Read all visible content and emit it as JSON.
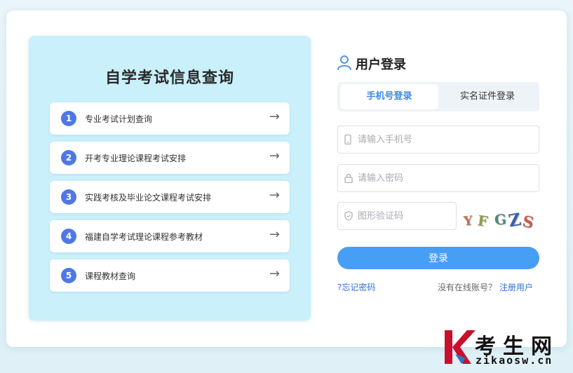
{
  "left_panel": {
    "title": "自学考试信息查询",
    "items": [
      {
        "num": "1",
        "label": "专业考试计划查询"
      },
      {
        "num": "2",
        "label": "开考专业理论课程考试安排"
      },
      {
        "num": "3",
        "label": "实践考核及毕业论文课程考试安排"
      },
      {
        "num": "4",
        "label": "福建自学考试理论课程参考教材"
      },
      {
        "num": "5",
        "label": "课程教材查询"
      }
    ],
    "arrow": "→"
  },
  "login": {
    "title": "用户登录",
    "tabs": {
      "phone": "手机号登录",
      "idcard": "实名证件登录"
    },
    "phone_placeholder": "请输入手机号",
    "password_placeholder": "请输入密码",
    "captcha_placeholder": "图形验证码",
    "captcha_text": "YFGZS",
    "submit_label": "登录",
    "forgot_label": "?忘记密码",
    "register_hint": "没有在线账号？",
    "register_label": "注册用户"
  },
  "watermark": {
    "brand": "考生网",
    "url": "zikaosw.cn"
  },
  "colors": {
    "accent": "#479ef5",
    "panel": "#c9f0fb",
    "badge": "#4f78e6",
    "link": "#2f6fd6"
  }
}
